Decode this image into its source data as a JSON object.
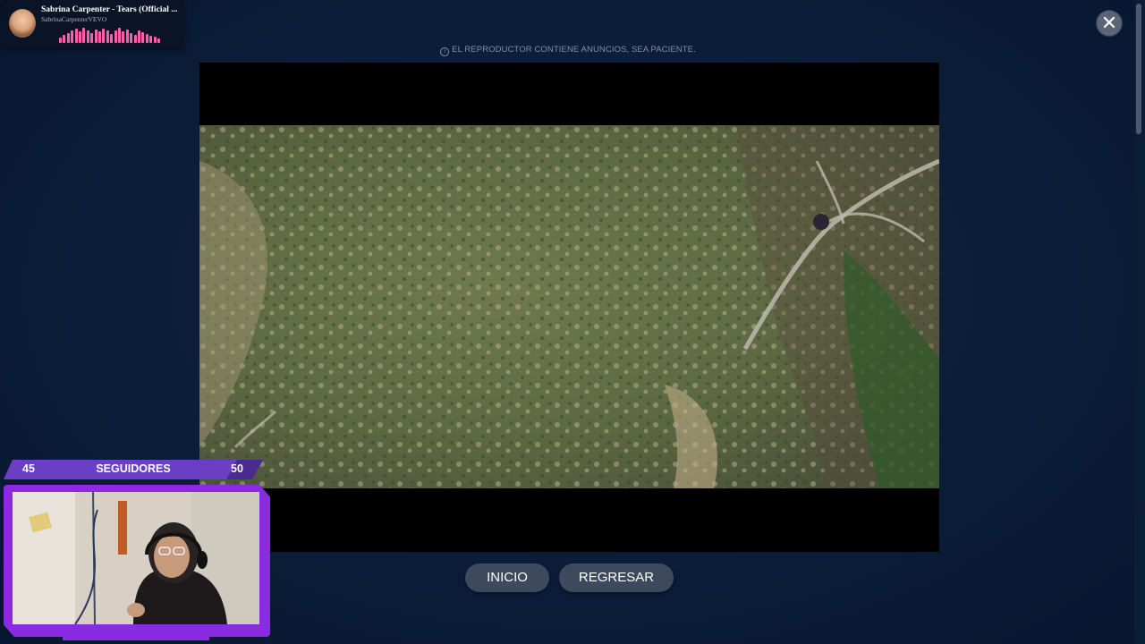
{
  "now_playing": {
    "title": "Sabrina Carpenter - Tears (Official ...",
    "channel": "SabrinaCarpenterVEVO",
    "bar_color": "#ff5fa8",
    "bar_levels": [
      0.35,
      0.5,
      0.6,
      0.75,
      0.9,
      0.7,
      0.95,
      0.8,
      0.6,
      0.85,
      0.7,
      0.9,
      0.75,
      0.55,
      0.8,
      0.95,
      0.7,
      0.85,
      0.6,
      0.5,
      0.75,
      0.65,
      0.55,
      0.45,
      0.4,
      0.3
    ]
  },
  "close_icon": "close-icon",
  "ad_notice": {
    "icon": "info-icon",
    "text": "EL REPRODUCTOR CONTIENE ANUNCIOS, SEA PACIENTE."
  },
  "buttons": {
    "inicio": "INICIO",
    "regresar": "REGRESAR"
  },
  "followers": {
    "current": "45",
    "label": "SEGUIDORES",
    "goal": "50",
    "progress": 0.9,
    "accent": "#8a2be2"
  }
}
